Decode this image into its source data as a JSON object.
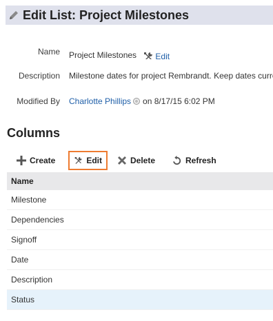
{
  "header": {
    "title": "Edit List: Project Milestones",
    "icon": "pencil-icon"
  },
  "details": {
    "name_label": "Name",
    "name_value": "Project Milestones",
    "edit_link": "Edit",
    "description_label": "Description",
    "description_value": "Milestone dates for project Rembrandt. Keep dates current.",
    "modified_by_label": "Modified By",
    "modified_by_user": "Charlotte Phillips",
    "modified_on": "on 8/17/15 6:02 PM"
  },
  "columns": {
    "title": "Columns",
    "toolbar": {
      "create": "Create",
      "edit": "Edit",
      "delete": "Delete",
      "refresh": "Refresh"
    },
    "table": {
      "header": "Name",
      "rows": [
        "Milestone",
        "Dependencies",
        "Signoff",
        "Date",
        "Description",
        "Status"
      ],
      "selected_row": "Status"
    }
  },
  "colors": {
    "accent_link": "#1f5fa8",
    "selected_border": "#ee7b30",
    "header_bg": "#dfe1ec",
    "selected_row_bg": "#e6f2fb"
  }
}
